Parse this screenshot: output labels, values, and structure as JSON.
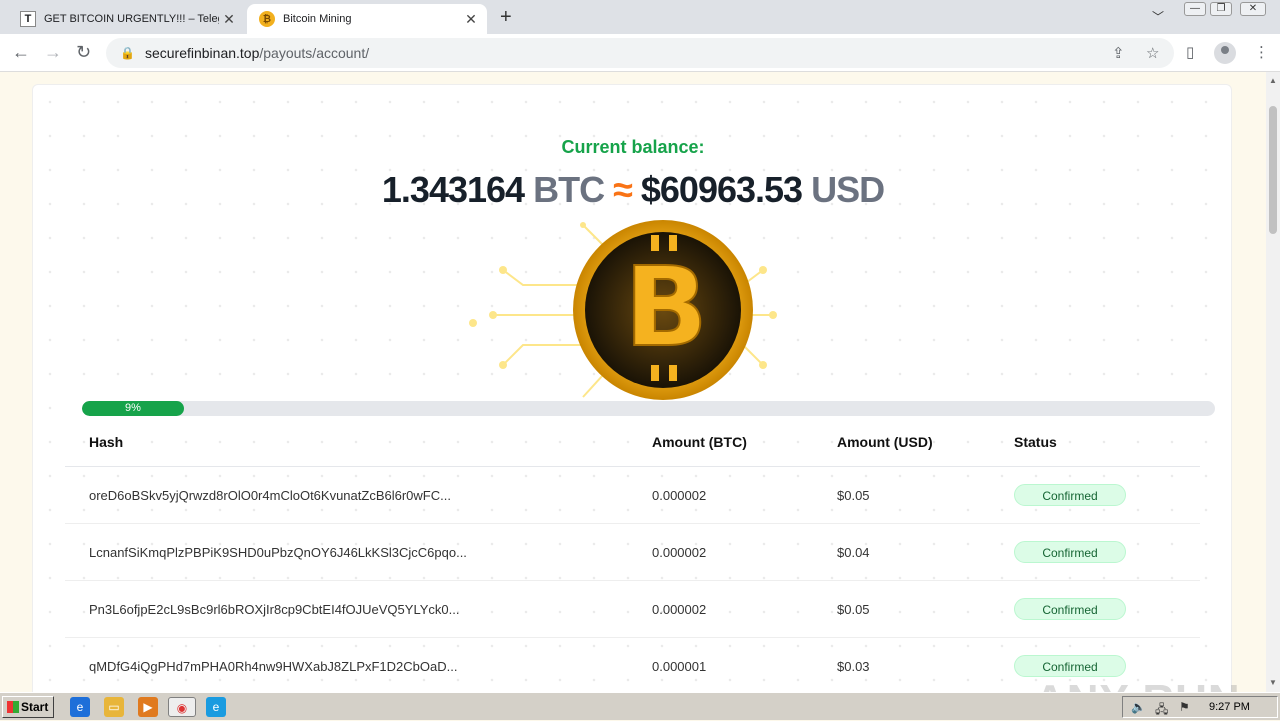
{
  "browser": {
    "tabs": [
      {
        "title": "GET BITCOIN URGENTLY!!! – Telegram",
        "favicon": "T"
      },
      {
        "title": "Bitcoin Mining",
        "favicon": "₿"
      }
    ],
    "url_host": "securefinbinan.top",
    "url_path": "/payouts/account/"
  },
  "balance": {
    "label": "Current balance:",
    "btc_amount": "1.343164",
    "btc_unit": "BTC",
    "approx": "≈",
    "usd_amount": "$60963.53",
    "usd_unit": "USD",
    "coin_symbol": "B"
  },
  "progress": {
    "value_percent": 9,
    "label": "9%"
  },
  "table": {
    "headers": [
      "Hash",
      "Amount (BTC)",
      "Amount (USD)",
      "Status"
    ],
    "rows": [
      {
        "hash": "oreD6oBSkv5yjQrwzd8rOlO0r4mCloOt6KvunatZcB6l6r0wFC...",
        "btc": "0.000002",
        "usd": "$0.05",
        "status": "Confirmed"
      },
      {
        "hash": "LcnanfSiKmqPlzPBPiK9SHD0uPbzQnOY6J46LkKSl3CjcC6pqo...",
        "btc": "0.000002",
        "usd": "$0.04",
        "status": "Confirmed"
      },
      {
        "hash": "Pn3L6ofjpE2cL9sBc9rl6bROXjIr8cp9CbtEI4fOJUeVQ5YLYck0...",
        "btc": "0.000002",
        "usd": "$0.05",
        "status": "Confirmed"
      },
      {
        "hash": "qMDfG4iQgPHd7mPHA0Rh4nw9HWXabJ8ZLPxF1D2CbOaD...",
        "btc": "0.000001",
        "usd": "$0.03",
        "status": "Confirmed"
      }
    ]
  },
  "watermark": "ANY RUN",
  "taskbar": {
    "start_label": "Start",
    "clock": "9:27 PM"
  },
  "colors": {
    "accent_green": "#16a34a",
    "approx_orange": "#f97316",
    "coin_gold": "#f2b01e"
  }
}
